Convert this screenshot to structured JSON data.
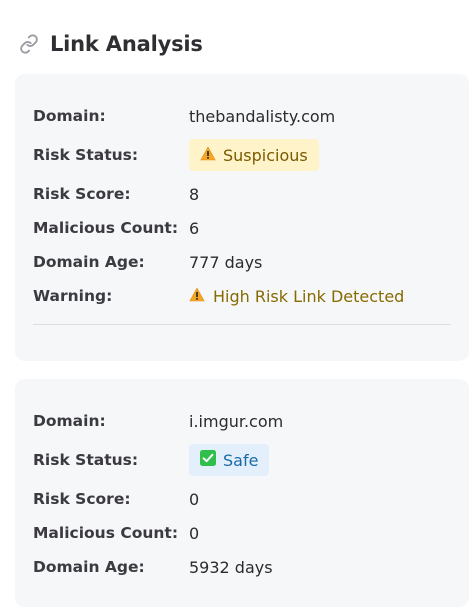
{
  "header": {
    "title": "Link Analysis",
    "icon": "link-icon"
  },
  "labels": {
    "domain": "Domain:",
    "risk_status": "Risk Status:",
    "risk_score": "Risk Score:",
    "malicious_count": "Malicious Count:",
    "domain_age": "Domain Age:",
    "warning": "Warning:"
  },
  "links": [
    {
      "domain": "thebandalisty.com",
      "risk_status": "Suspicious",
      "risk_status_icon": "warning-icon",
      "risk_score": "8",
      "malicious_count": "6",
      "domain_age": "777 days",
      "warning": "High Risk Link Detected",
      "warning_icon": "warning-icon"
    },
    {
      "domain": "i.imgur.com",
      "risk_status": "Safe",
      "risk_status_icon": "check-icon",
      "risk_score": "0",
      "malicious_count": "0",
      "domain_age": "5932 days"
    }
  ],
  "colors": {
    "suspicious_bg": "#fff3c9",
    "suspicious_text": "#7a5a00",
    "safe_bg": "#e3f0fb",
    "safe_text": "#1a6aa8",
    "check_green": "#2fbf4a",
    "warning_orange": "#f4a623"
  }
}
